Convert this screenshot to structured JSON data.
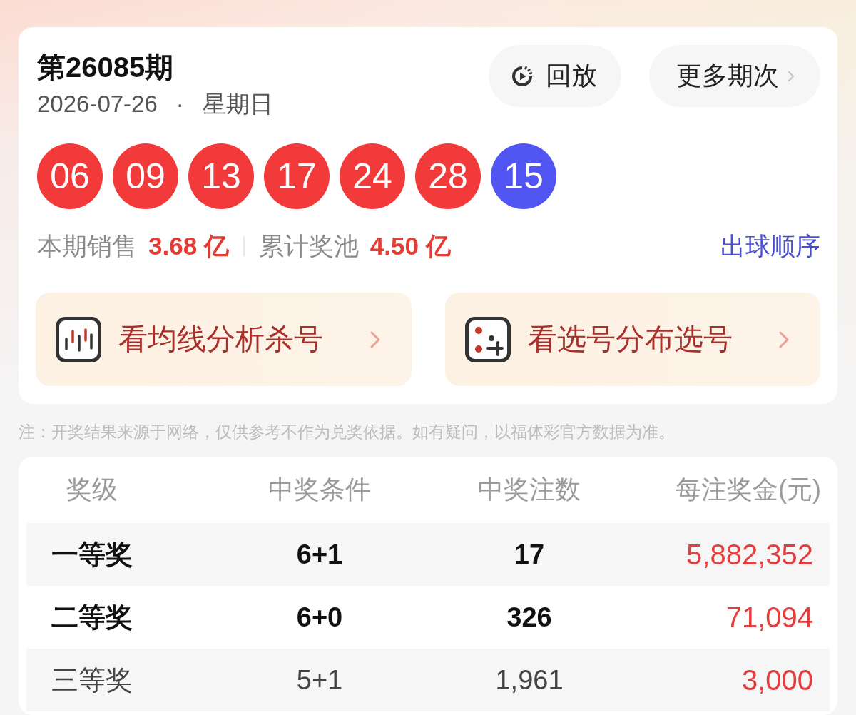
{
  "draw": {
    "title": "第26085期",
    "date": "2026-07-26",
    "separator": "·",
    "weekday": "星期日"
  },
  "buttons": [
    {
      "kind": "replay",
      "label": "回放"
    },
    {
      "kind": "more",
      "label": "更多期次"
    }
  ],
  "balls": [
    {
      "number": "06",
      "color": "#f23a3a"
    },
    {
      "number": "09",
      "color": "#f23a3a"
    },
    {
      "number": "13",
      "color": "#f23a3a"
    },
    {
      "number": "17",
      "color": "#f23a3a"
    },
    {
      "number": "24",
      "color": "#f23a3a"
    },
    {
      "number": "28",
      "color": "#f23a3a"
    },
    {
      "number": "15",
      "color": "#5155f2"
    }
  ],
  "stats": [
    {
      "label": "本期销售",
      "value": "3.68 亿"
    },
    {
      "label": "累计奖池",
      "value": "4.50 亿"
    }
  ],
  "order_link": "出球顺序",
  "shortcuts": [
    {
      "kind": "trend",
      "label": "看均线分析杀号"
    },
    {
      "kind": "distribution",
      "label": "看选号分布选号"
    }
  ],
  "note": "注：开奖结果来源于网络，仅供参考不作为兑奖依据。如有疑问，以福体彩官方数据为准。",
  "prize_table": {
    "columns": [
      "奖级",
      "中奖条件",
      "中奖注数",
      "每注奖金(元)"
    ],
    "rows": [
      {
        "level": "一等奖",
        "condition": "6+1",
        "winners": "17",
        "prize": "5,882,352",
        "emphasized": true
      },
      {
        "level": "二等奖",
        "condition": "6+0",
        "winners": "326",
        "prize": "71,094",
        "emphasized": true
      },
      {
        "level": "三等奖",
        "condition": "5+1",
        "winners": "1,961",
        "prize": "3,000",
        "emphasized": false
      }
    ]
  }
}
